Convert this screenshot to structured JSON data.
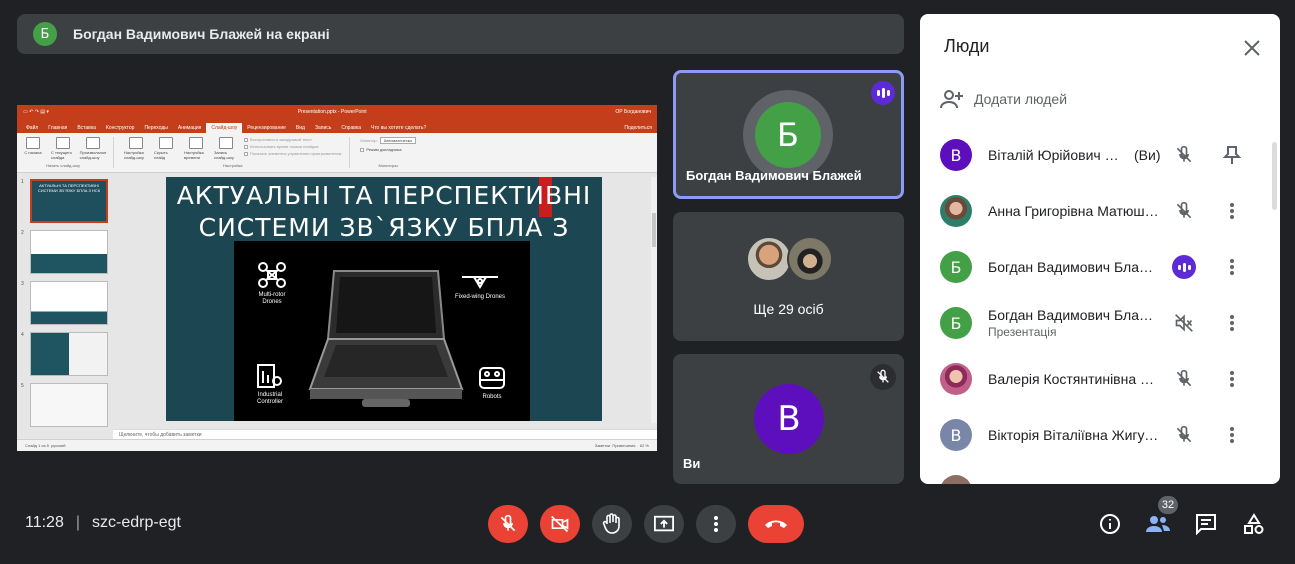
{
  "banner": {
    "avatar_letter": "Б",
    "text": "Богдан Вадимович Блажей на екрані"
  },
  "presentation": {
    "window_title": "Presentation.pptx - PowerPoint",
    "user": "ОР Богданович",
    "tabs": [
      "Файл",
      "Главная",
      "Вставка",
      "Конструктор",
      "Переходы",
      "Анимация",
      "Слайд-шоу",
      "Рецензирование",
      "Вид",
      "Запись",
      "Справка",
      "Что вы хотите сделать?"
    ],
    "active_tab": "Слайд-шоу",
    "share_label": "Поделиться",
    "ribbon": {
      "start_group": "Начать слайд-шоу",
      "btn_from_start": "С начала",
      "btn_from_current": "С текущего слайда",
      "btn_custom": "Произвольное слайд-шоу",
      "btn_setup": "Настройка слайд-шоу",
      "btn_hide": "Скрыть слайд",
      "btn_rehearse": "Настройка времени",
      "btn_record": "Запись слайд-шоу",
      "setup_group": "Настройка",
      "check_narrations": "Воспроизвести закадровый текст",
      "check_timings": "Использовать время показа слайдов",
      "check_controls": "Показать элементы управления проигрывателем",
      "monitor_label": "Монитор:",
      "monitor_value": "Автоматически",
      "check_presenter": "Режим докладчика",
      "monitors_group": "Мониторы"
    },
    "thumb_title": "АКТУАЛЬНІ ТА ПЕРСПЕКТИВНІ СИСТЕМИ ЗВ`ЯЗКУ БПЛА З НСК",
    "thumb_numbers": [
      "1",
      "2",
      "3",
      "4",
      "5"
    ],
    "slide": {
      "title_line1": "АКТУАЛЬНІ ТА ПЕРСПЕКТИВНІ",
      "title_line2": "СИСТЕМИ ЗВ`ЯЗКУ БПЛА З НСК",
      "item_multirotor": "Multi-rotor Drones",
      "item_fixedwing": "Fixed-wing Drones",
      "item_industrial": "Industrial Controller",
      "item_robots": "Robots"
    },
    "notes_placeholder": "Щелкните, чтобы добавить заметки",
    "status_left": "Слайд 1 из 5",
    "status_lang": "русский",
    "status_notes": "Заметки",
    "status_comments": "Примечания",
    "status_zoom": "62 %"
  },
  "tiles": {
    "tile1": {
      "avatar_letter": "Б",
      "name": "Богдан Вадимович Блажей"
    },
    "tile2": {
      "more": "Ще 29 осіб"
    },
    "tile3": {
      "avatar_letter": "В",
      "name": "Ви"
    }
  },
  "panel": {
    "title": "Люди",
    "add_people": "Додати людей",
    "you_suffix": "(Ви)",
    "people": [
      {
        "letter": "В",
        "name": "Віталій Юрійович Л...",
        "color": "#5e0fbd"
      },
      {
        "letter": "",
        "name": "Анна Григорівна Матюшенко",
        "color": ""
      },
      {
        "letter": "Б",
        "name": "Богдан Вадимович Блажей",
        "color": "#43a047"
      },
      {
        "letter": "Б",
        "name": "Богдан Вадимович Блажей",
        "sub": "Презентація",
        "color": "#43a047"
      },
      {
        "letter": "",
        "name": "Валерія Костянтинівна Савченко",
        "color": ""
      },
      {
        "letter": "В",
        "name": "Вікторія Віталіївна Жигула",
        "color": "#7986a8"
      }
    ]
  },
  "bottom": {
    "time": "11:28",
    "separator": "|",
    "meeting_code": "szc-edrp-egt",
    "people_count": "32"
  }
}
